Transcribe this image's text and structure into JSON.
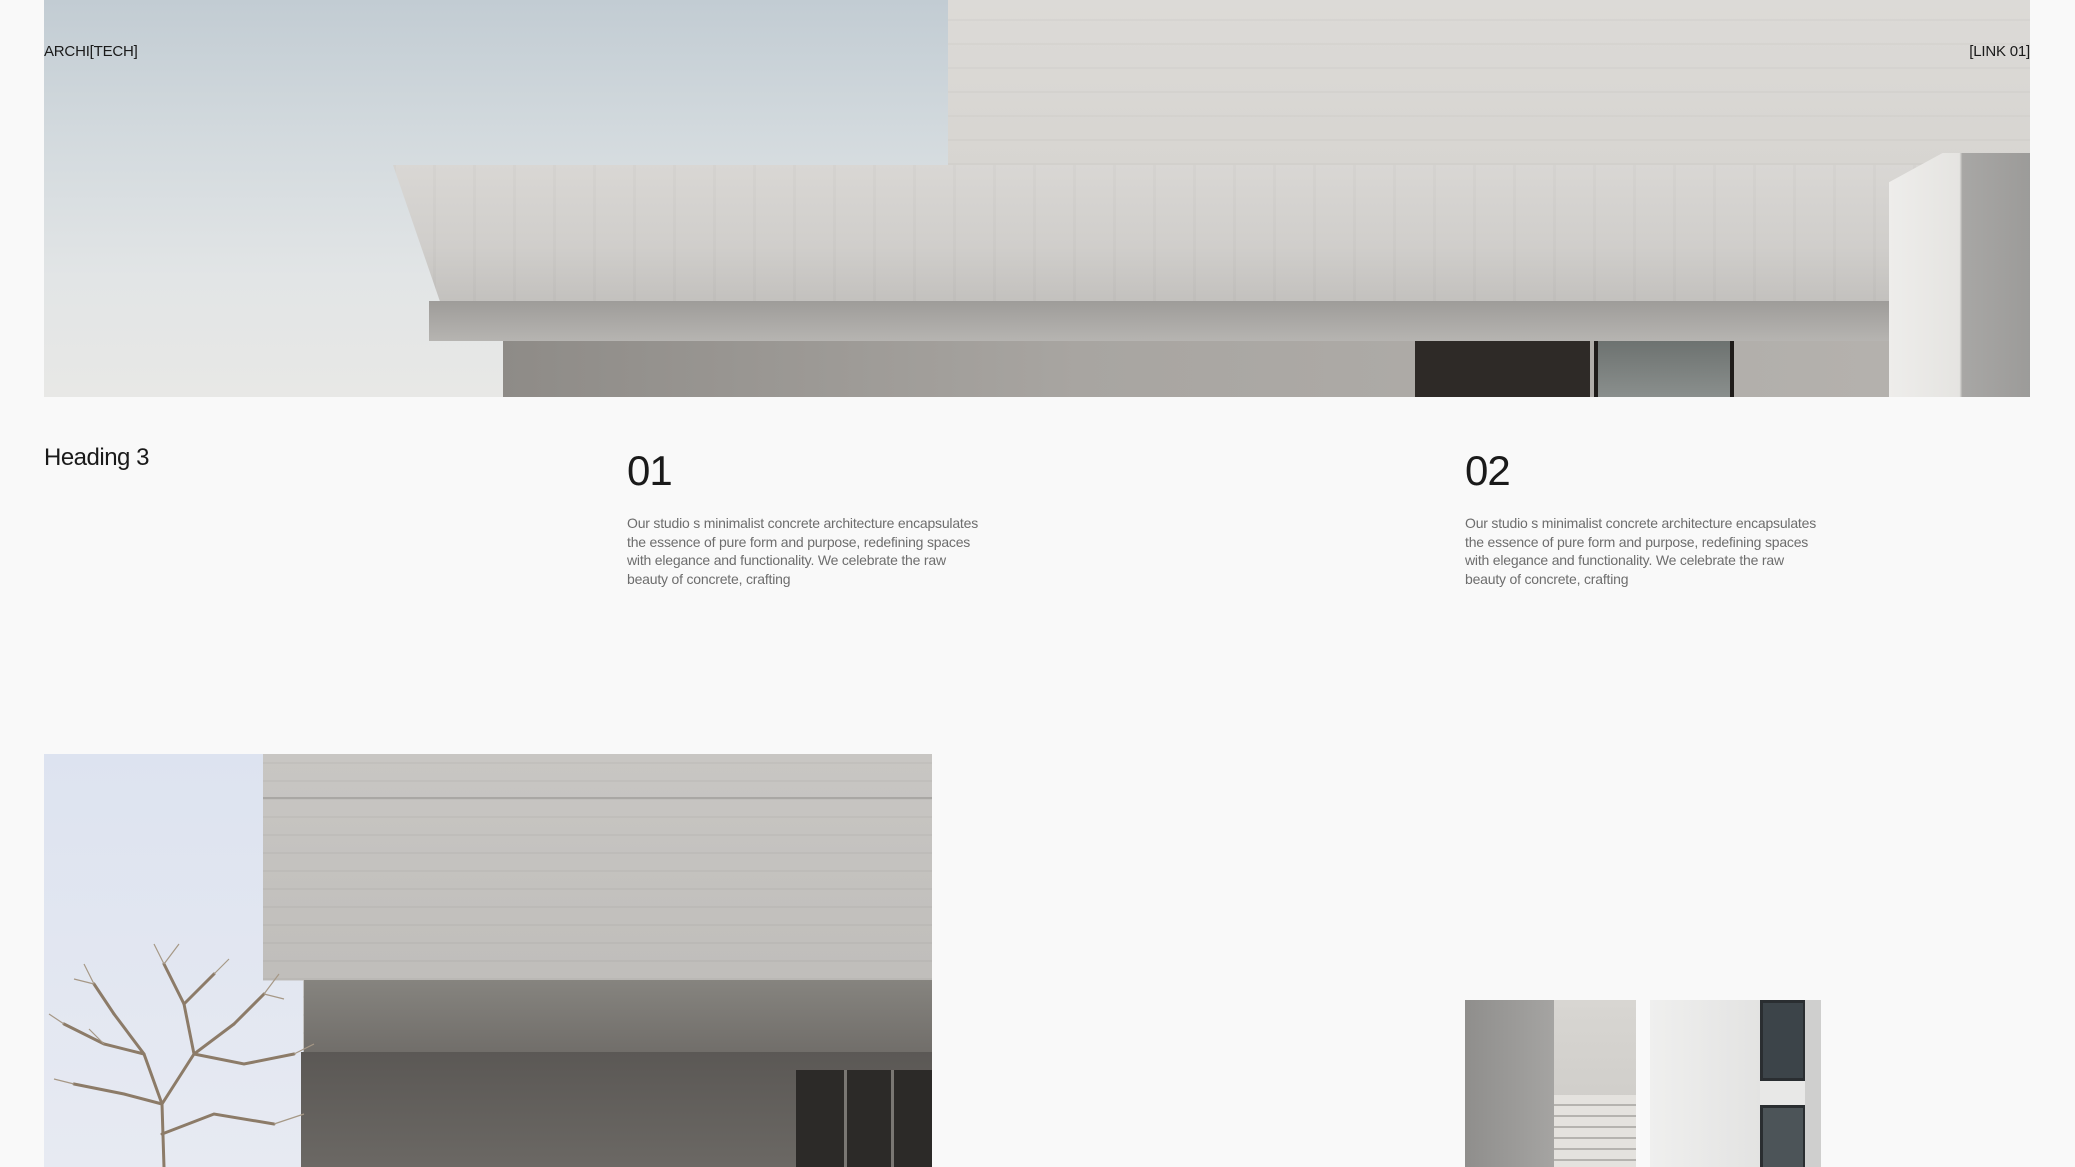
{
  "nav": {
    "logo": "ARCHI[TECH]",
    "link": "[LINK 01]"
  },
  "hero": {
    "image_description": "concrete-building-hero"
  },
  "section": {
    "heading": "Heading 3",
    "features": [
      {
        "number": "01",
        "text": "Our studio s minimalist concrete architecture encapsulates the essence of pure form and purpose, redefining spaces with elegance and functionality. We celebrate the raw beauty of concrete, crafting"
      },
      {
        "number": "02",
        "text": "Our studio s minimalist concrete architecture encapsulates the essence of pure form and purpose, redefining spaces with elegance and functionality. We celebrate the raw beauty of concrete, crafting"
      }
    ]
  },
  "gallery": {
    "images": [
      "concrete-facade-with-tree",
      "concrete-stairs",
      "white-wall-with-windows"
    ]
  },
  "colors": {
    "background": "#f9f9f9",
    "text": "#1a1a1a",
    "muted_text": "#6d6d6d"
  }
}
